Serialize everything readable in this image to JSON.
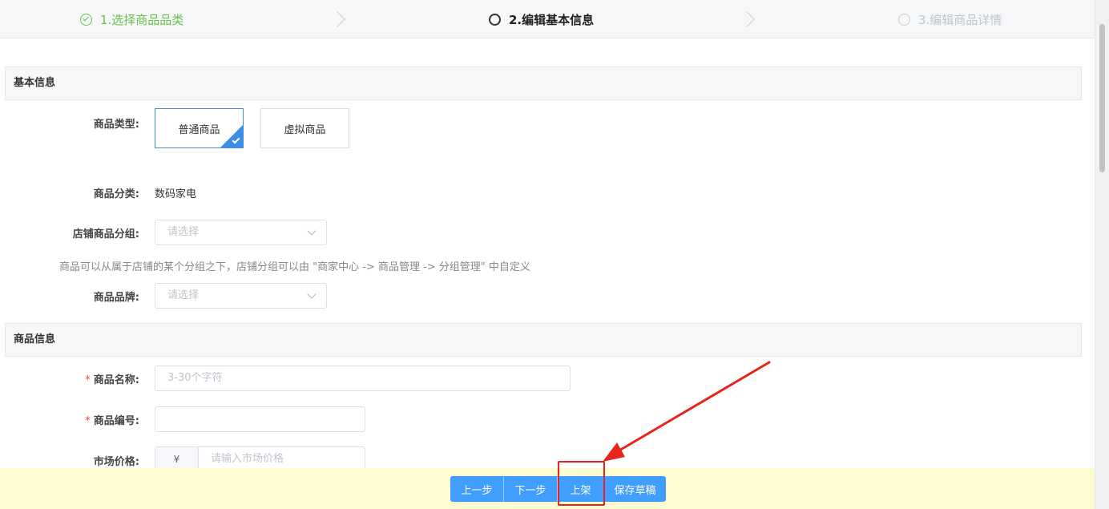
{
  "steps": [
    {
      "label": "1.选择商品品类",
      "state": "done"
    },
    {
      "label": "2.编辑基本信息",
      "state": "active"
    },
    {
      "label": "3.编辑商品详情",
      "state": "todo"
    }
  ],
  "sections": {
    "basic": "基本信息",
    "product": "商品信息"
  },
  "fields": {
    "type_label": "商品类型:",
    "type_options": [
      "普通商品",
      "虚拟商品"
    ],
    "category_label": "商品分类:",
    "category_value": "数码家电",
    "shop_group_label": "店铺商品分组:",
    "shop_group_placeholder": "请选择",
    "shop_group_hint": "商品可以从属于店铺的某个分组之下，店铺分组可以由 \"商家中心 -> 商品管理 -> 分组管理\" 中自定义",
    "brand_label": "商品品牌:",
    "brand_placeholder": "请选择",
    "name_label": "商品名称:",
    "name_placeholder": "3-30个字符",
    "code_label": "商品编号:",
    "code_value": "",
    "market_price_label": "市场价格:",
    "market_price_prefix": "¥",
    "market_price_placeholder": "请输入市场价格",
    "required_mark": "*"
  },
  "footer": {
    "prev": "上一步",
    "next": "下一步",
    "list": "上架",
    "draft": "保存草稿"
  },
  "colors": {
    "accent": "#409eff",
    "done": "#6cbf4c",
    "annotation": "#e8241c",
    "footer_bg": "#fdfbd0"
  }
}
